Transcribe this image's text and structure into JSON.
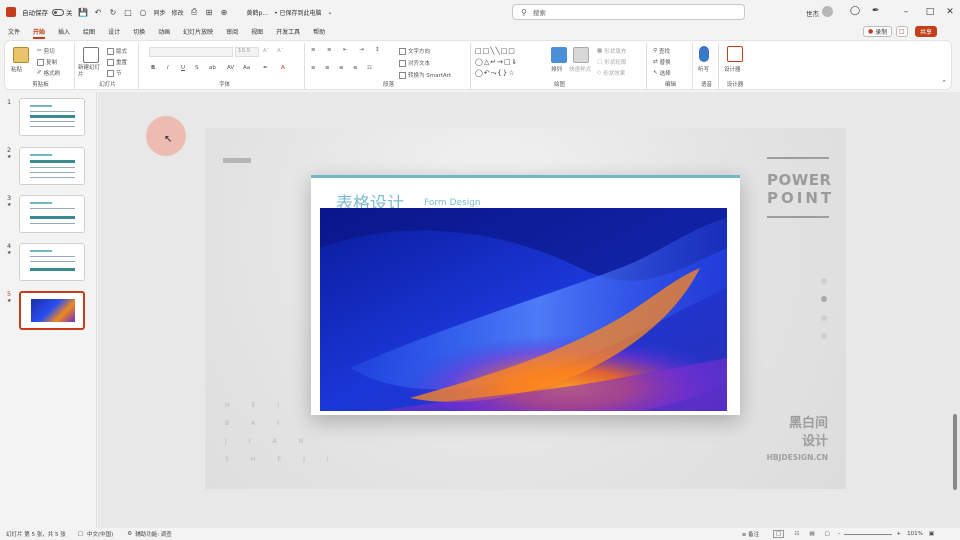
{
  "titlebar": {
    "autosave_label": "自动保存",
    "autosave_state": "关",
    "quick_access": [
      "保存",
      "撤消",
      "重做",
      "从头开始"
    ],
    "sync_label": "同步",
    "changes_label": "修改",
    "doc_name": "黄鹤p...",
    "doc_status": "• 已保存到此电脑",
    "search_placeholder": "搜索",
    "user": "世杰",
    "window_controls": [
      "minimize",
      "maximize",
      "close"
    ]
  },
  "tabs": {
    "items": [
      "文件",
      "开始",
      "插入",
      "绘图",
      "设计",
      "切换",
      "动画",
      "幻灯片放映",
      "审阅",
      "视图",
      "开发工具",
      "帮助"
    ],
    "active": "开始",
    "record_label": "录制",
    "share_label": "共享"
  },
  "ribbon": {
    "groups": [
      "剪贴板",
      "幻灯片",
      "字体",
      "段落",
      "绘图",
      "编辑",
      "语音",
      "设计器"
    ],
    "clipboard": {
      "paste": "粘贴",
      "cut": "剪切",
      "copy": "复制",
      "format_painter": "格式刷"
    },
    "slides": {
      "new_slide": "新建幻灯片",
      "layout": "版式",
      "reset": "重置",
      "section": "节"
    },
    "font": {
      "font_name": "",
      "font_size": "10.5"
    },
    "paragraph": {
      "text_direction": "文字方向",
      "align_text": "对齐文本",
      "smartart": "转换为 SmartArt"
    },
    "drawing": {
      "arrange": "排列",
      "quick_styles": "快速样式",
      "shape_fill": "形状填充",
      "shape_outline": "形状轮廓",
      "shape_effects": "形状效果"
    },
    "editing": {
      "find": "查找",
      "replace": "替换",
      "select": "选择"
    },
    "voice": {
      "dictate": "听写"
    },
    "designer": {
      "designer": "设计器"
    }
  },
  "thumbnails": [
    {
      "number": "1",
      "star": "",
      "active": false
    },
    {
      "number": "2",
      "star": "★",
      "active": false
    },
    {
      "number": "3",
      "star": "★",
      "active": false
    },
    {
      "number": "4",
      "star": "★",
      "active": false
    },
    {
      "number": "5",
      "star": "★",
      "active": true
    }
  ],
  "slide": {
    "title": "表格设计",
    "subtitle": "Form Design",
    "power": "POWER",
    "point": "POINT",
    "brand_line1": "黑白间",
    "brand_line2": "设计",
    "brand_url": "HBJDESIGN.CN",
    "vertical_rows": [
      "HEI",
      "BAI",
      "JIAN",
      "SHEJI"
    ]
  },
  "statusbar": {
    "slide_info": "幻灯片 第 5 张，共 5 张",
    "language": "中文(中国)",
    "accessibility": "辅助功能: 调查",
    "notes": "备注",
    "zoom": "101%"
  },
  "colors": {
    "accent": "#c43e1c",
    "card_title": "#7dbbd0",
    "teal_bar": "#76b6c4"
  }
}
